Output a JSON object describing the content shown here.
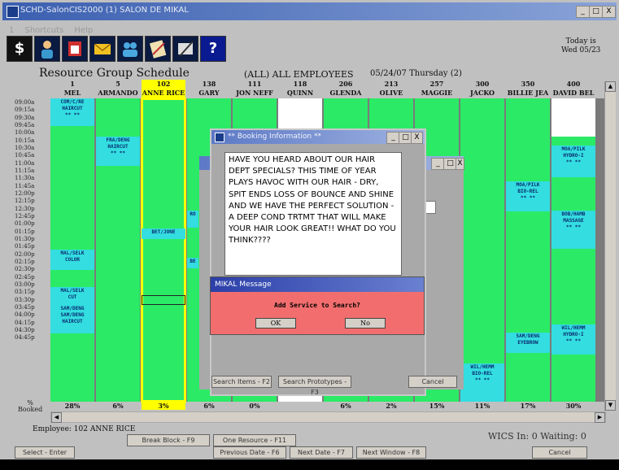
{
  "window": {
    "title": "SCHD-SalonCIS2000 (1) SALON DE MIKAL",
    "btn_min": "_",
    "btn_max": "□",
    "btn_close": "X"
  },
  "menu": [
    "1",
    "Shortcuts",
    "Help"
  ],
  "toolbar": {
    "dollar": "$",
    "help": "?"
  },
  "today": {
    "line1": "Today is",
    "line2": "Wed 05/23"
  },
  "schedule": {
    "heading": "Resource Group Schedule",
    "group": "(ALL) ALL EMPLOYEES",
    "date": "05/24/07 Thursday  (2)",
    "booked_label": "% Booked"
  },
  "columns": [
    {
      "num": "1",
      "name": "MEL",
      "pct": "28%"
    },
    {
      "num": "5",
      "name": "ARMANDO",
      "pct": "6%"
    },
    {
      "num": "102",
      "name": "ANNE RICE",
      "pct": "3%"
    },
    {
      "num": "138",
      "name": "GARY",
      "pct": "6%"
    },
    {
      "num": "111",
      "name": "JON NEFF",
      "pct": "0%"
    },
    {
      "num": "118",
      "name": "QUINN",
      "pct": ""
    },
    {
      "num": "206",
      "name": "GLENDA KE",
      "pct": "6%"
    },
    {
      "num": "213",
      "name": "OLIVE DREE",
      "pct": "2%"
    },
    {
      "num": "257",
      "name": "MAGGIE",
      "pct": "15%"
    },
    {
      "num": "300",
      "name": "JACKO",
      "pct": "11%"
    },
    {
      "num": "350",
      "name": "BILLIE JEA",
      "pct": "17%"
    },
    {
      "num": "400",
      "name": "DAVID BEL",
      "pct": "30%"
    }
  ],
  "times": [
    "09:00a",
    "09:15a",
    "09:30a",
    "09:45a",
    "10:00a",
    "10:15a",
    "10:30a",
    "10:45a",
    "11:00a",
    "11:15a",
    "11:30a",
    "11:45a",
    "12:00p",
    "12:15p",
    "12:30p",
    "12:45p",
    "01:00p",
    "01:15p",
    "01:30p",
    "01:45p",
    "02:00p",
    "02:15p",
    "02:30p",
    "02:45p",
    "03:00p",
    "03:15p",
    "03:30p",
    "03:45p",
    "04:00p",
    "04:15p",
    "04:30p",
    "04:45p"
  ],
  "appointments": {
    "mel_1": {
      "l1": "COM/C/RE",
      "l2": "HAIRCUT",
      "l3": "**  **"
    },
    "arm_1": {
      "l1": "FRA/DENG",
      "l2": "HAIRCUT",
      "l3": "**  **"
    },
    "mel_2": {
      "l1": "MAL/SELK",
      "l2": "COLOR",
      "l3": ""
    },
    "mel_3": {
      "l1": "MAL/SELK",
      "l2": "CUT",
      "l3": ""
    },
    "mel_4": {
      "l1": "SAM/DENG",
      "l2": "SAM/DENG",
      "l3": "HAIRCUT"
    },
    "anne_1": {
      "l1": "BET/JONE",
      "l2": "",
      "l3": ""
    },
    "gary_1": {
      "l1": "RO",
      "l2": "",
      "l3": ""
    },
    "gary_2": {
      "l1": "BE",
      "l2": "",
      "l3": ""
    },
    "billie_1": {
      "l1": "MOA/PILK",
      "l2": "BIO-REL",
      "l3": "**  **"
    },
    "billie_2": {
      "l1": "SAM/DENG",
      "l2": "EYEBROW",
      "l3": ""
    },
    "david_1": {
      "l1": "MOA/PILK",
      "l2": "HYDRO-I",
      "l3": "**  **"
    },
    "david_2": {
      "l1": "BOB/HAMB",
      "l2": "MASSAGE",
      "l3": "**  **"
    },
    "david_3": {
      "l1": "WIL/HEMM",
      "l2": "HYDRO-I",
      "l3": "**  **"
    },
    "jacko_1": {
      "l1": "WIL/HEMM",
      "l2": "BIO-REL",
      "l3": "**  **"
    }
  },
  "bottom": {
    "employee": "Employee: 102   ANNE RICE",
    "wics": "WICS  In: 0  Waiting: 0",
    "btn_break": "Break Block - F9",
    "btn_one_resource": "One Resource - F11",
    "btn_select": "Select - Enter",
    "btn_prev_date": "Previous Date - F6",
    "btn_next_date": "Next Date - F7",
    "btn_next_window": "Next Window - F8",
    "btn_cancel": "Cancel"
  },
  "booking_window": {
    "title": "** Booking Information **",
    "message": "HAVE YOU HEARD ABOUT OUR HAIR DEPT SPECIALS? THIS TIME OF YEAR PLAYS HAVOC WITH OUR HAIR - DRY, SPIT ENDS LOSS OF BOUNCE AND SHINE AND WE HAVE THE PERFECT SOLUTION - A DEEP COND TRTMT THAT WILL MAKE YOUR HAIR LOOK GREAT!!  WHAT DO YOU THINK????",
    "btn_search_items": "Search Items - F2",
    "btn_search_prototypes": "Search Prototypes - F3",
    "btn_cancel": "Cancel"
  },
  "mikal_message": {
    "title": "MIKAL Message",
    "text": "Add Service to Search?",
    "btn_ok": "OK",
    "btn_no": "No"
  },
  "colors": {
    "grid_green": "#2bea66",
    "appt_cyan": "#33dde0",
    "selected_yellow": "#ffff00",
    "message_red": "#f26e6e"
  }
}
